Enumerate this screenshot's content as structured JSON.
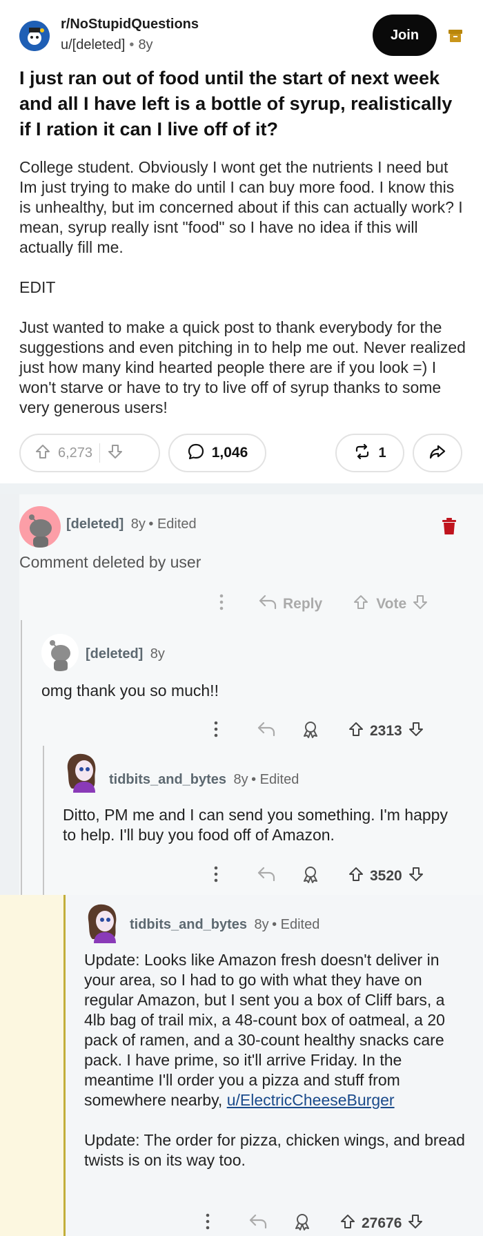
{
  "post": {
    "subreddit": "r/NoStupidQuestions",
    "author": "u/[deleted]",
    "age": "8y",
    "join_label": "Join",
    "title": "I just ran out of food until the start of next week and all I have left is a bottle of syrup, realistically if I ration it can I live off of it?",
    "body": [
      "College student. Obviously I wont get the nutrients I need but Im just trying to make do until I can buy more food. I know this is unhealthy, but im concerned about if this can actually work? I mean, syrup really isnt \"food\" so I have no idea if this will actually fill me.",
      "EDIT",
      "Just wanted to make a quick post to thank everybody for the suggestions and even pitching in to help me out. Never realized just how many kind hearted people there are if you look =) I won't starve or have to try to live off of syrup thanks to some very generous users!"
    ],
    "votes": "6,273",
    "comments": "1,046",
    "crossposts": "1"
  },
  "comments": [
    {
      "author": "[deleted]",
      "age": "8y",
      "edited": "Edited",
      "text": "Comment deleted by user",
      "reply_label": "Reply",
      "vote_label": "Vote"
    },
    {
      "author": "[deleted]",
      "age": "8y",
      "text": "omg thank you so much!!",
      "score": "2313"
    },
    {
      "author": "tidbits_and_bytes",
      "age": "8y",
      "edited": "Edited",
      "text": "Ditto, PM me and I can send you something. I'm happy to help. I'll buy you food off of Amazon.",
      "score": "3520"
    },
    {
      "author": "tidbits_and_bytes",
      "age": "8y",
      "edited": "Edited",
      "text_part1": "Update: Looks like Amazon fresh doesn't deliver in your area, so I had to go with what they have on regular Amazon, but I sent you a box of Cliff bars, a 4lb bag of trail mix, a 48-count box of oatmeal, a 20 pack of ramen, and a 30-count healthy snacks care pack. I have prime, so it'll arrive Friday. In the meantime I'll order you a pizza and stuff from somewhere nearby,",
      "link": "u/ElectricCheeseBurger",
      "text_part2": "Update: The order for pizza, chicken wings, and bread twists is on its way too.",
      "score": "27676"
    }
  ],
  "colors": {
    "join_bg": "#0a0a0a",
    "delete_icon": "#c0141e",
    "highlight_bar": "#c2ae3a",
    "link": "#1a4a8a"
  }
}
